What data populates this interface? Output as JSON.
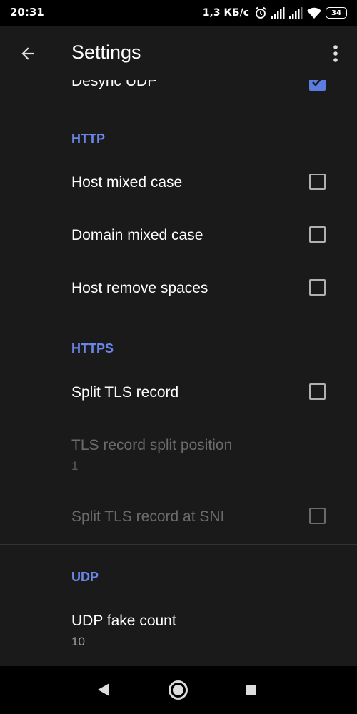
{
  "status_bar": {
    "time": "20:31",
    "net_speed": "1,3 КБ/с",
    "battery": "34",
    "icons": [
      "alarm-icon",
      "signal-icon",
      "signal-icon",
      "wifi-icon",
      "battery-icon"
    ]
  },
  "app_bar": {
    "title": "Settings",
    "back_icon": "arrow-back-icon",
    "menu_icon": "more-vert-icon"
  },
  "top_partial": {
    "title": "Desync UDP",
    "checked": true
  },
  "sections": {
    "http": {
      "header": "HTTP",
      "items": [
        {
          "title": "Host mixed case",
          "checked": false
        },
        {
          "title": "Domain mixed case",
          "checked": false
        },
        {
          "title": "Host remove spaces",
          "checked": false
        }
      ]
    },
    "https": {
      "header": "HTTPS",
      "split_tls": {
        "title": "Split TLS record",
        "checked": false
      },
      "split_position": {
        "title": "TLS record split position",
        "summary": "1",
        "enabled": false
      },
      "split_sni": {
        "title": "Split TLS record at SNI",
        "checked": false,
        "enabled": false
      }
    },
    "udp": {
      "header": "UDP",
      "fake_count": {
        "title": "UDP fake count",
        "summary": "10"
      }
    }
  },
  "colors": {
    "accent": "#6b86e8",
    "background": "#1a1a1a",
    "checkbox_checked": "#5b7de2"
  },
  "nav_bar": {
    "icons": [
      "nav-back-icon",
      "nav-home-icon",
      "nav-recents-icon"
    ]
  }
}
